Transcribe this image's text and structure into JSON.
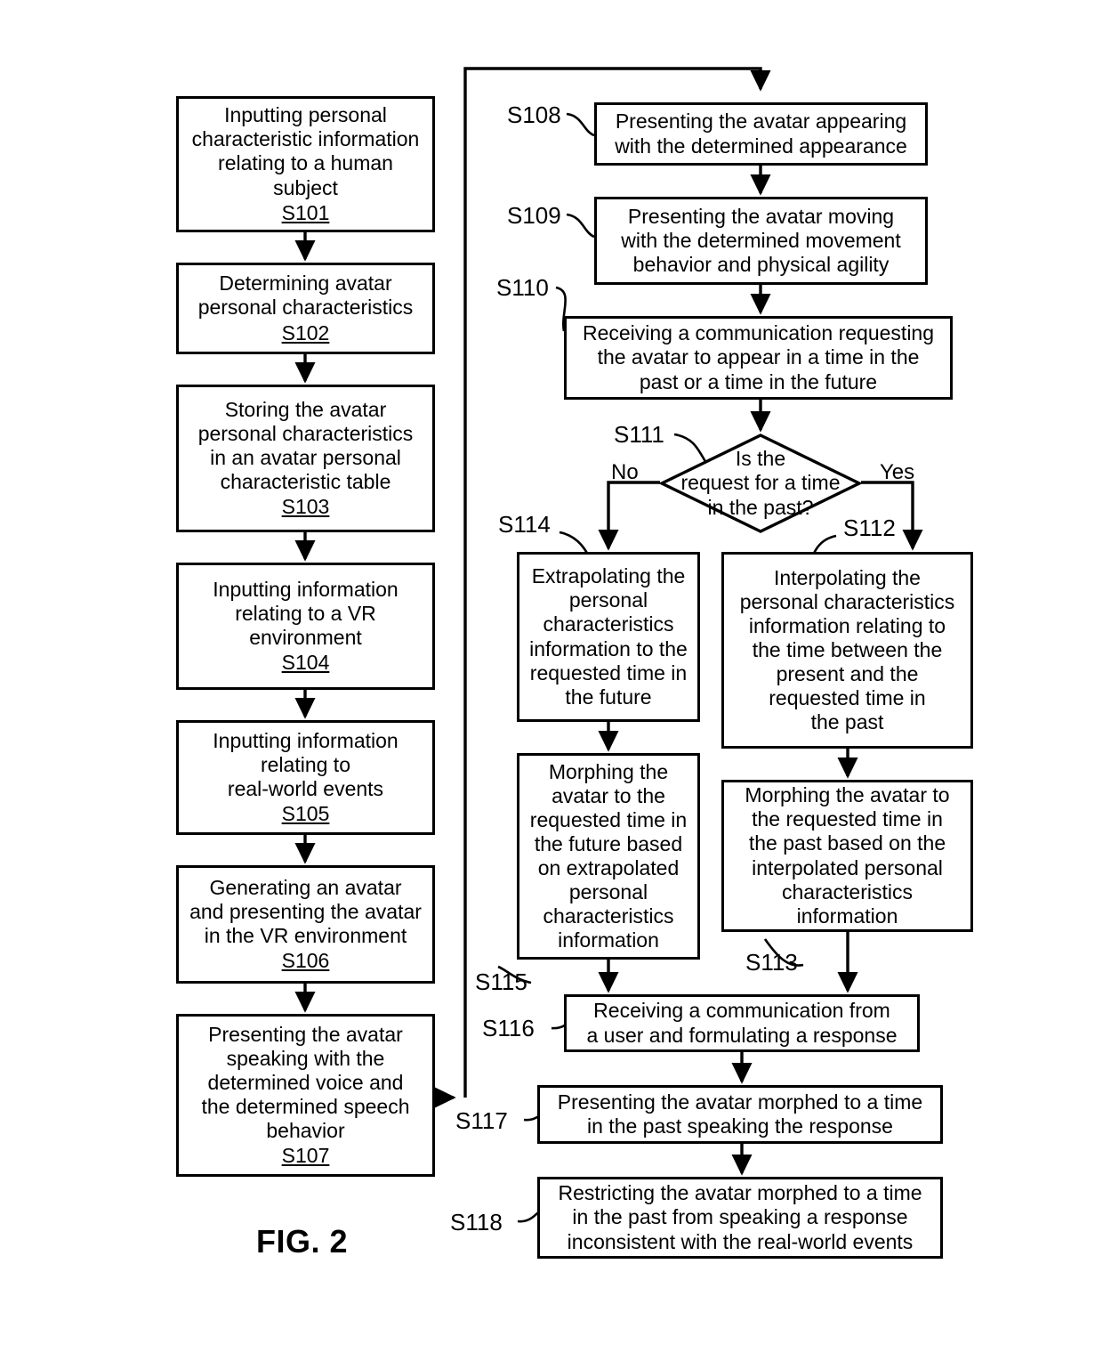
{
  "figure": {
    "caption": "FIG. 2",
    "title": "FIG. 2"
  },
  "nodes": {
    "s101": {
      "text": "Inputting personal\ncharacteristic information\nrelating to a human\nsubject",
      "step": "S101"
    },
    "s102": {
      "text": "Determining avatar\npersonal characteristics",
      "step": "S102"
    },
    "s103": {
      "text": "Storing the avatar\npersonal characteristics\nin an avatar personal\ncharacteristic table",
      "step": "S103"
    },
    "s104": {
      "text": "Inputting information\nrelating to a VR\nenvironment",
      "step": "S104"
    },
    "s105": {
      "text": "Inputting information\nrelating to\nreal-world events",
      "step": "S105"
    },
    "s106": {
      "text": "Generating an avatar\nand presenting the avatar\nin the VR environment",
      "step": "S106"
    },
    "s107": {
      "text": "Presenting the avatar\nspeaking with the\ndetermined voice and\nthe determined speech\nbehavior",
      "step": "S107"
    },
    "s108": {
      "text": "Presenting the avatar appearing\nwith the determined appearance",
      "step": "S108"
    },
    "s109": {
      "text": "Presenting the avatar moving\nwith the determined movement\nbehavior and physical agility",
      "step": "S109"
    },
    "s110": {
      "text": "Receiving a communication requesting\nthe avatar to appear in a time in the\npast or a time in the future",
      "step": "S110"
    },
    "s111": {
      "text": "Is the\nrequest for a time\nin the past?",
      "step": "S111"
    },
    "s112": {
      "text": "Interpolating the\npersonal characteristics\ninformation relating to\nthe time between the\npresent and the\nrequested time in\nthe past",
      "step": "S112"
    },
    "s113": {
      "text": "Morphing the avatar to\nthe requested time in\nthe past based on the\ninterpolated personal\ncharacteristics\ninformation",
      "step": "S113"
    },
    "s114": {
      "text": "Extrapolating the\npersonal\ncharacteristics\ninformation to the\nrequested time in\nthe future",
      "step": "S114"
    },
    "s115": {
      "text": "Morphing the\navatar to the\nrequested time in\nthe future based\non extrapolated\npersonal\ncharacteristics\ninformation",
      "step": "S115"
    },
    "s116": {
      "text": "Receiving a communication from\na user and formulating a response",
      "step": "S116"
    },
    "s117": {
      "text": "Presenting the avatar morphed to a time\nin the past speaking the response",
      "step": "S117"
    },
    "s118": {
      "text": "Restricting the avatar morphed to a time\nin the past from speaking a response\ninconsistent with the real-world events",
      "step": "S118"
    }
  },
  "branch_labels": {
    "no": "No",
    "yes": "Yes"
  },
  "colors": {
    "stroke": "#000000",
    "background": "#ffffff",
    "text": "#000000"
  }
}
